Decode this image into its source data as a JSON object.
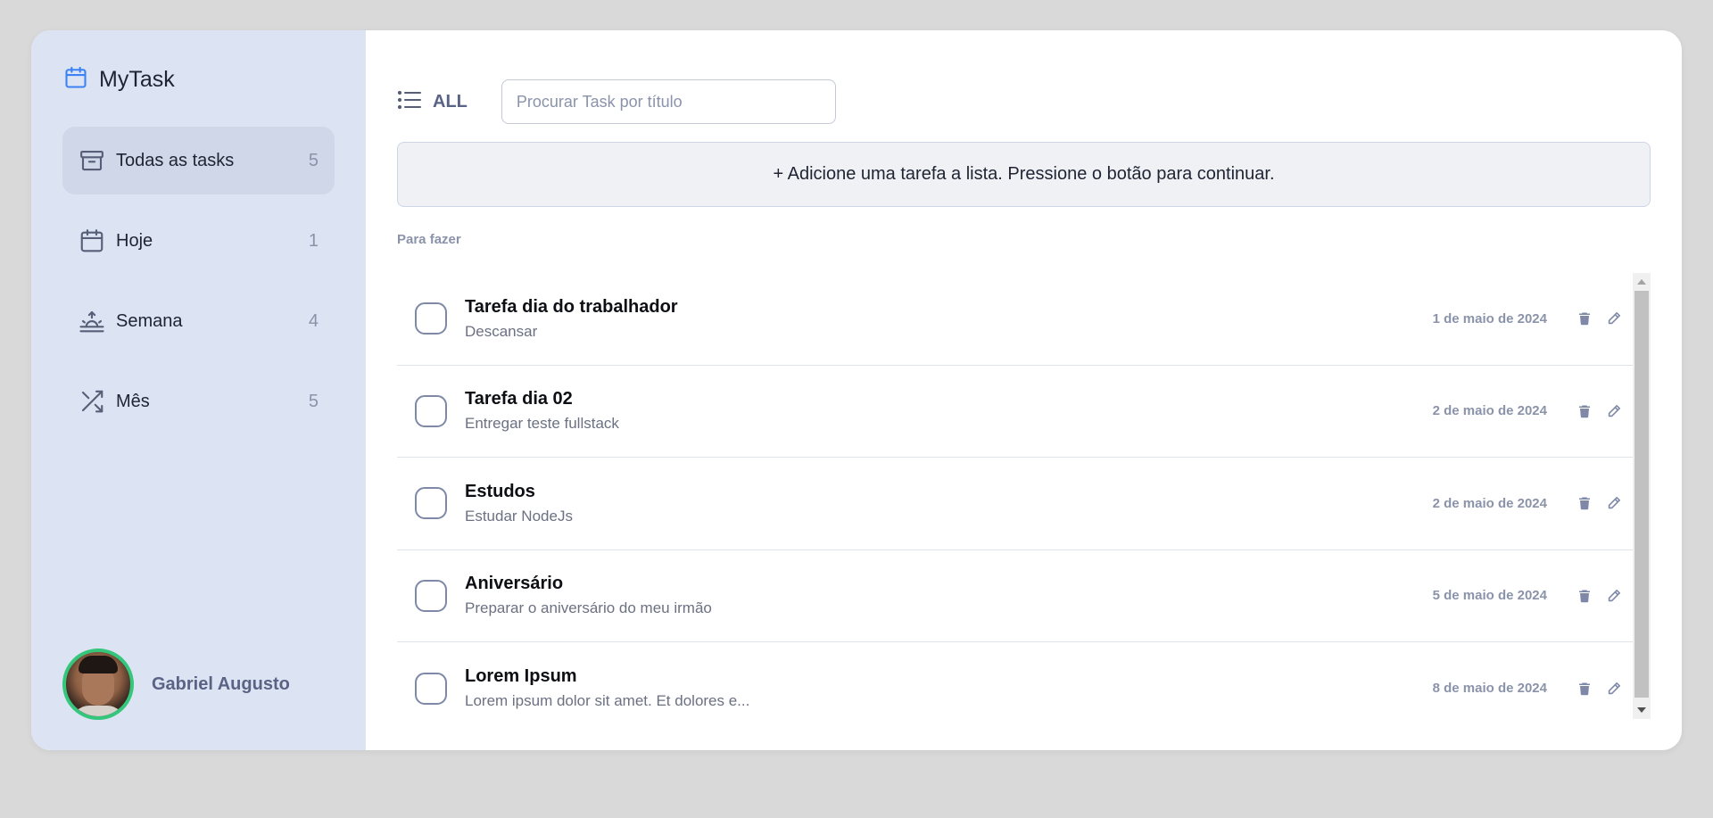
{
  "brand": {
    "name": "MyTask",
    "icon": "calendar-icon"
  },
  "sidebar": {
    "items": [
      {
        "label": "Todas as tasks",
        "count": "5",
        "icon": "archive-icon",
        "active": true
      },
      {
        "label": "Hoje",
        "count": "1",
        "icon": "calendar-icon",
        "active": false
      },
      {
        "label": "Semana",
        "count": "4",
        "icon": "sunrise-icon",
        "active": false
      },
      {
        "label": "Mês",
        "count": "5",
        "icon": "shuffle-icon",
        "active": false
      }
    ]
  },
  "profile": {
    "name": "Gabriel Augusto"
  },
  "toolbar": {
    "filter_label": "ALL",
    "search_placeholder": "Procurar Task por título"
  },
  "add_task": {
    "label": "+ Adicione uma tarefa a lista. Pressione o botão para continuar."
  },
  "section": {
    "title": "Para fazer"
  },
  "tasks": [
    {
      "title": "Tarefa dia do trabalhador",
      "description": "Descansar",
      "date": "1 de maio de 2024"
    },
    {
      "title": "Tarefa dia 02",
      "description": "Entregar teste fullstack",
      "date": "2 de maio de 2024"
    },
    {
      "title": "Estudos",
      "description": "Estudar NodeJs",
      "date": "2 de maio de 2024"
    },
    {
      "title": "Aniversário",
      "description": "Preparar o aniversário do meu irmão",
      "date": "5 de maio de 2024"
    },
    {
      "title": "Lorem Ipsum",
      "description": "Lorem ipsum dolor sit amet. Et dolores e...",
      "date": "8 de maio de 2024"
    }
  ],
  "colors": {
    "accent": "#3b82f6",
    "sidebar_bg": "#dce3f2",
    "active_item_bg": "#cfd7e8",
    "avatar_ring": "#34c77b",
    "muted_text": "#8a93aa"
  }
}
